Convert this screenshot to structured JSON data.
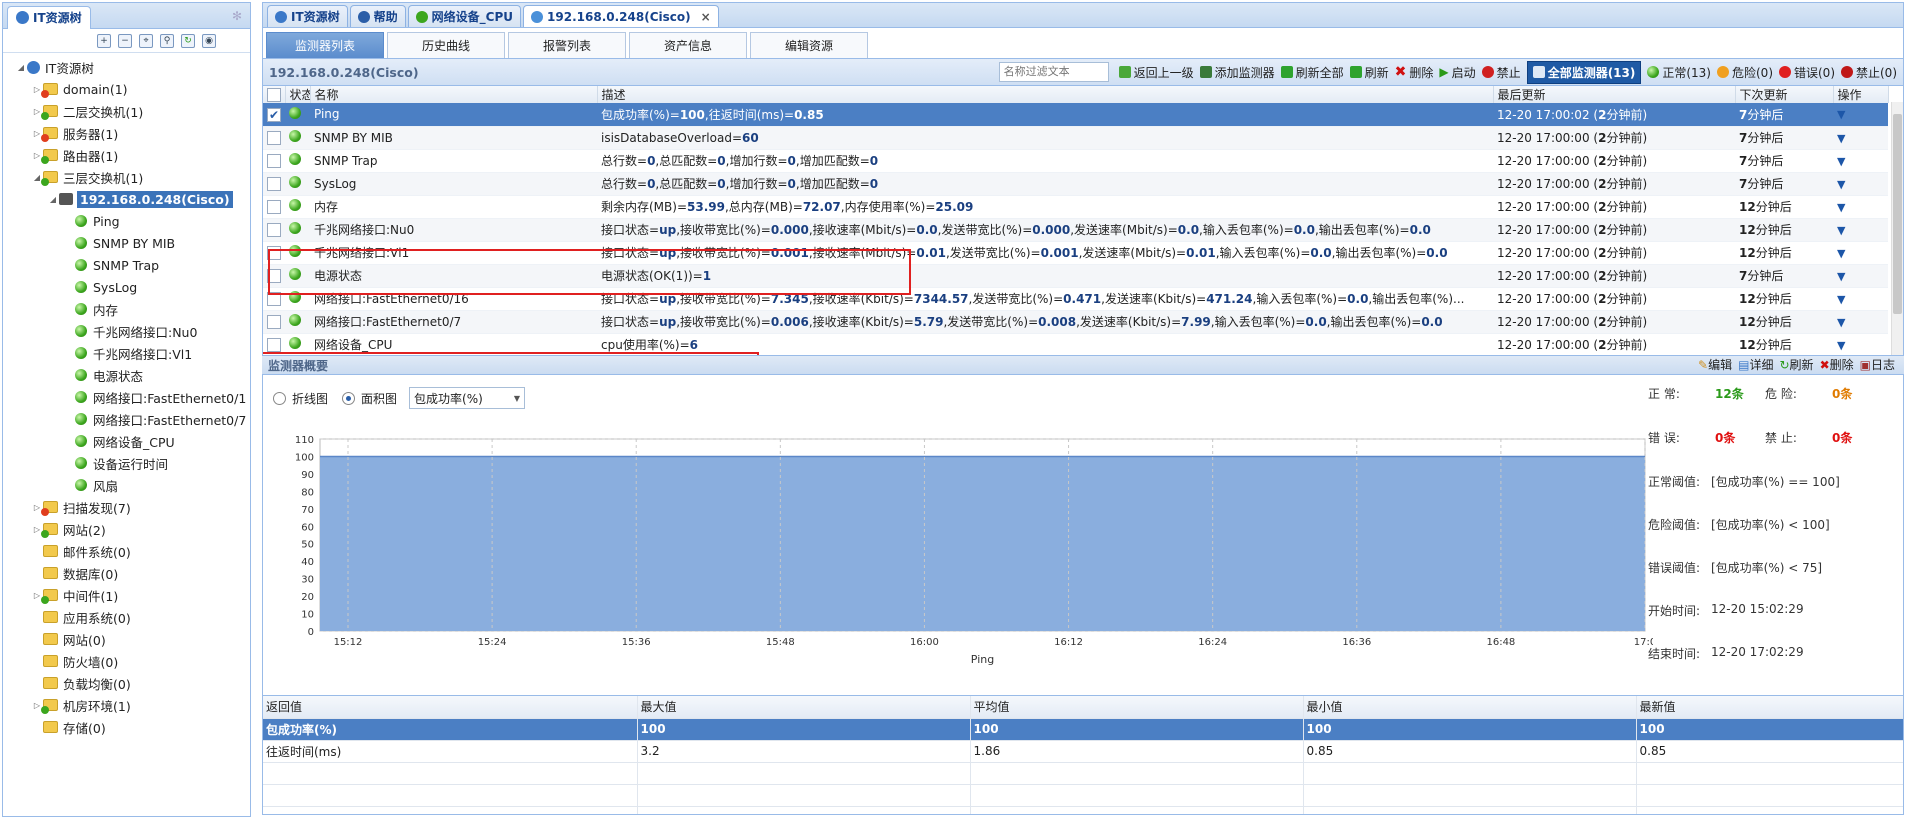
{
  "left_panel": {
    "tab_label": "IT资源树",
    "tree": [
      {
        "label": "IT资源树",
        "depth": 0,
        "expanded": true,
        "kind": "root"
      },
      {
        "label": "domain(1)",
        "depth": 1,
        "kind": "folder-red"
      },
      {
        "label": "二层交换机(1)",
        "depth": 1,
        "kind": "folder-green"
      },
      {
        "label": "服务器(1)",
        "depth": 1,
        "kind": "folder-red"
      },
      {
        "label": "路由器(1)",
        "depth": 1,
        "kind": "folder-green"
      },
      {
        "label": "三层交换机(1)",
        "depth": 1,
        "expanded": true,
        "kind": "folder-green"
      },
      {
        "label": "192.168.0.248(Cisco)",
        "depth": 2,
        "expanded": true,
        "kind": "device",
        "selected": true
      },
      {
        "label": "Ping",
        "depth": 3,
        "kind": "monitor"
      },
      {
        "label": "SNMP BY MIB",
        "depth": 3,
        "kind": "monitor"
      },
      {
        "label": "SNMP Trap",
        "depth": 3,
        "kind": "monitor"
      },
      {
        "label": "SysLog",
        "depth": 3,
        "kind": "monitor"
      },
      {
        "label": "内存",
        "depth": 3,
        "kind": "monitor"
      },
      {
        "label": "千兆网络接口:Nu0",
        "depth": 3,
        "kind": "monitor"
      },
      {
        "label": "千兆网络接口:Vl1",
        "depth": 3,
        "kind": "monitor"
      },
      {
        "label": "电源状态",
        "depth": 3,
        "kind": "monitor"
      },
      {
        "label": "网络接口:FastEthernet0/1",
        "depth": 3,
        "kind": "monitor"
      },
      {
        "label": "网络接口:FastEthernet0/7",
        "depth": 3,
        "kind": "monitor"
      },
      {
        "label": "网络设备_CPU",
        "depth": 3,
        "kind": "monitor"
      },
      {
        "label": "设备运行时间",
        "depth": 3,
        "kind": "monitor"
      },
      {
        "label": "风扇",
        "depth": 3,
        "kind": "monitor"
      },
      {
        "label": "扫描发现(7)",
        "depth": 1,
        "kind": "folder-red"
      },
      {
        "label": "网站(2)",
        "depth": 1,
        "kind": "folder-green"
      },
      {
        "label": "邮件系统(0)",
        "depth": 1,
        "kind": "folder"
      },
      {
        "label": "数据库(0)",
        "depth": 1,
        "kind": "folder"
      },
      {
        "label": "中间件(1)",
        "depth": 1,
        "kind": "folder-green"
      },
      {
        "label": "应用系统(0)",
        "depth": 1,
        "kind": "folder"
      },
      {
        "label": "网站(0)",
        "depth": 1,
        "kind": "folder"
      },
      {
        "label": "防火墙(0)",
        "depth": 1,
        "kind": "folder"
      },
      {
        "label": "负载均衡(0)",
        "depth": 1,
        "kind": "folder"
      },
      {
        "label": "机房环境(1)",
        "depth": 1,
        "kind": "folder-green"
      },
      {
        "label": "存储(0)",
        "depth": 1,
        "kind": "folder"
      }
    ]
  },
  "top_tabs": [
    "IT资源树",
    "帮助",
    "网络设备_CPU",
    "192.168.0.248(Cisco)"
  ],
  "sub_tabs": [
    "监测器列表",
    "历史曲线",
    "报警列表",
    "资产信息",
    "编辑资源"
  ],
  "grid_toolbar": {
    "title": "192.168.0.248(Cisco)",
    "search_placeholder": "名称过滤文本",
    "buttons": [
      "返回上一级",
      "添加监测器",
      "刷新全部",
      "刷新",
      "删除",
      "启动",
      "禁止"
    ],
    "all_monitors": "全部监测器(13)",
    "status_counts": [
      "正常(13)",
      "危险(0)",
      "错误(0)",
      "禁止(0)"
    ]
  },
  "grid_headers": [
    "状态",
    "名称",
    "描述",
    "最后更新",
    "下次更新",
    "操作"
  ],
  "monitors": [
    {
      "name": "Ping",
      "desc": "包成功率(%)=100,往返时间(ms)=0.85",
      "last": "12-20 17:00:02 (2分钟前)",
      "next": "7分钟后",
      "checked": true
    },
    {
      "name": "SNMP BY MIB",
      "desc": "isisDatabaseOverload=60",
      "last": "12-20 17:00:00 (2分钟前)",
      "next": "7分钟后"
    },
    {
      "name": "SNMP Trap",
      "desc": "总行数=0,总匹配数=0,增加行数=0,增加匹配数=0",
      "last": "12-20 17:00:00 (2分钟前)",
      "next": "7分钟后"
    },
    {
      "name": "SysLog",
      "desc": "总行数=0,总匹配数=0,增加行数=0,增加匹配数=0",
      "last": "12-20 17:00:00 (2分钟前)",
      "next": "7分钟后"
    },
    {
      "name": "内存",
      "desc": "剩余内存(MB)=53.99,总内存(MB)=72.07,内存使用率(%)=25.09",
      "last": "12-20 17:00:00 (2分钟前)",
      "next": "12分钟后"
    },
    {
      "name": "千兆网络接口:Nu0",
      "desc": "接口状态=up,接收带宽比(%)=0.000,接收速率(Mbit/s)=0.0,发送带宽比(%)=0.000,发送速率(Mbit/s)=0.0,输入丢包率(%)=0.0,输出丢包率(%)=0.0",
      "last": "12-20 17:00:00 (2分钟前)",
      "next": "12分钟后"
    },
    {
      "name": "千兆网络接口:Vl1",
      "desc": "接口状态=up,接收带宽比(%)=0.001,接收速率(Mbit/s)=0.01,发送带宽比(%)=0.001,发送速率(Mbit/s)=0.01,输入丢包率(%)=0.0,输出丢包率(%)=0.0",
      "last": "12-20 17:00:00 (2分钟前)",
      "next": "12分钟后"
    },
    {
      "name": "电源状态",
      "desc": "电源状态(OK(1))=1",
      "last": "12-20 17:00:00 (2分钟前)",
      "next": "7分钟后"
    },
    {
      "name": "网络接口:FastEthernet0/16",
      "desc": "接口状态=up,接收带宽比(%)=7.345,接收速率(Kbit/s)=7344.57,发送带宽比(%)=0.471,发送速率(Kbit/s)=471.24,输入丢包率(%)=0.0,输出丢包率(%)...",
      "last": "12-20 17:00:00 (2分钟前)",
      "next": "12分钟后"
    },
    {
      "name": "网络接口:FastEthernet0/7",
      "desc": "接口状态=up,接收带宽比(%)=0.006,接收速率(Kbit/s)=5.79,发送带宽比(%)=0.008,发送速率(Kbit/s)=7.99,输入丢包率(%)=0.0,输出丢包率(%)=0.0",
      "last": "12-20 17:00:00 (2分钟前)",
      "next": "12分钟后"
    },
    {
      "name": "网络设备_CPU",
      "desc": "cpu使用率(%)=6",
      "last": "12-20 17:00:00 (2分钟前)",
      "next": "12分钟后"
    }
  ],
  "overview": {
    "title": "监测器概要",
    "radio_line": "折线图",
    "radio_area": "面积图",
    "select_value": "包成功率(%)",
    "actions": [
      "编辑",
      "详细",
      "刷新",
      "删除",
      "日志"
    ],
    "stats": {
      "normal_label": "正    常:",
      "normal_value": "12条",
      "danger_label": "危    险:",
      "danger_value": "0条",
      "error_label": "错    误:",
      "error_value": "0条",
      "ban_label": "禁    止:",
      "ban_value": "0条",
      "normal_threshold_label": "正常阈值:",
      "normal_threshold": "[包成功率(%) == 100]",
      "danger_threshold_label": "危险阈值:",
      "danger_threshold": "[包成功率(%) < 100]",
      "error_threshold_label": "错误阈值:",
      "error_threshold": "[包成功率(%) < 75]",
      "start_label": "开始时间:",
      "start_time": "12-20 15:02:29",
      "end_label": "结束时间:",
      "end_time": "12-20 17:02:29"
    }
  },
  "chart_data": {
    "type": "area",
    "xlabel": "Ping",
    "ylabel": "",
    "x_ticks": [
      "15:12",
      "15:24",
      "15:36",
      "15:48",
      "16:00",
      "16:12",
      "16:24",
      "16:36",
      "16:48",
      "17:0"
    ],
    "y_ticks": [
      0,
      10,
      20,
      30,
      40,
      50,
      60,
      70,
      80,
      90,
      100,
      110
    ],
    "ylim": [
      0,
      110
    ],
    "series": [
      {
        "values": [
          100,
          100,
          100,
          100,
          100,
          100,
          100,
          100,
          100,
          100,
          100
        ]
      }
    ],
    "colors": {
      "fill": "#8aaede",
      "line": "#5b87c8"
    }
  },
  "returns": {
    "headers": [
      "返回值",
      "最大值",
      "平均值",
      "最小值",
      "最新值"
    ],
    "rows": [
      [
        "包成功率(%)",
        "100",
        "100",
        "100",
        "100"
      ],
      [
        "往返时间(ms)",
        "3.2",
        "1.86",
        "0.85",
        "0.85"
      ]
    ]
  }
}
